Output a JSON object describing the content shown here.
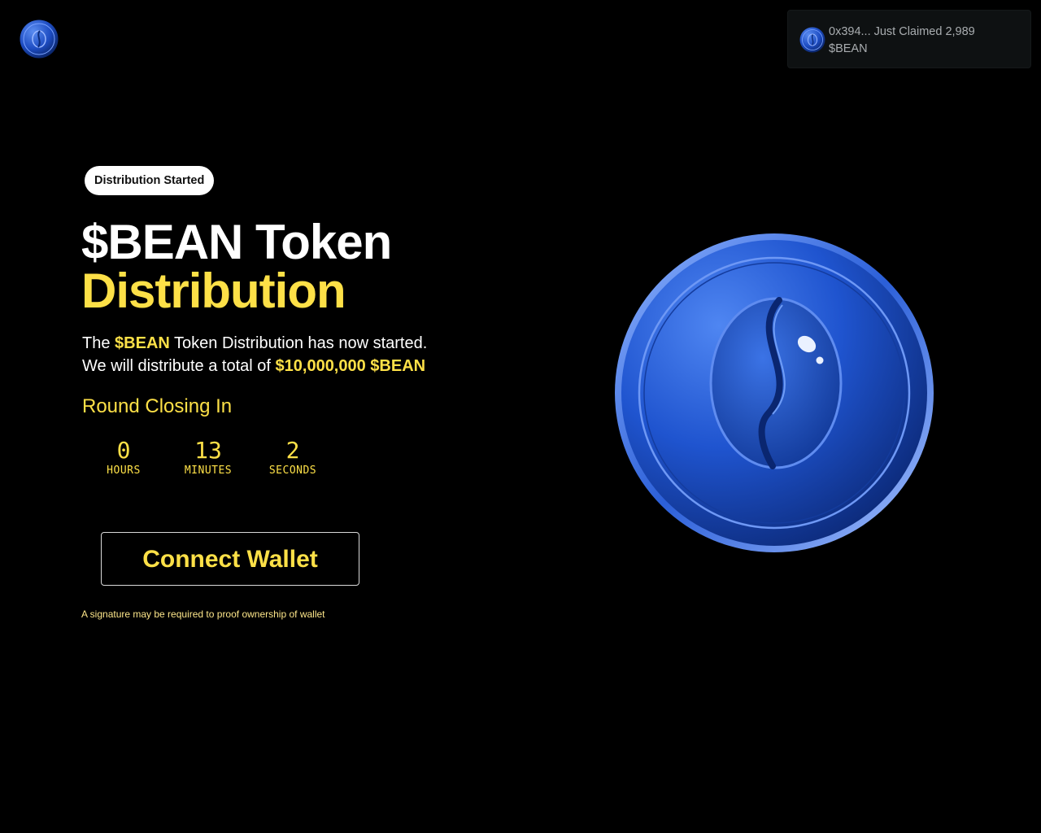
{
  "header": {
    "logo_icon": "bean-coin-icon"
  },
  "toast": {
    "icon": "bean-coin-icon",
    "message": "0x394... Just Claimed 2,989 $BEAN"
  },
  "hero": {
    "badge": "Distribution Started",
    "title_line1": "$BEAN Token",
    "title_line2": "Distribution",
    "desc_prefix": "The ",
    "desc_token": "$BEAN",
    "desc_mid": " Token Distribution has now started.",
    "desc_line2_prefix": "We will distribute a total of ",
    "desc_amount": "$10,000,000 $BEAN",
    "round_label": "Round Closing In",
    "countdown": [
      {
        "value": "0",
        "label": "HOURS"
      },
      {
        "value": "13",
        "label": "MINUTES"
      },
      {
        "value": "2",
        "label": "SECONDS"
      }
    ],
    "connect_label": "Connect Wallet",
    "note": "A signature may be required to proof ownership of wallet"
  },
  "image": {
    "icon": "bean-coin-icon"
  },
  "colors": {
    "accent": "#fde047",
    "background": "#000000",
    "coin_blue": "#1d4ed8"
  }
}
